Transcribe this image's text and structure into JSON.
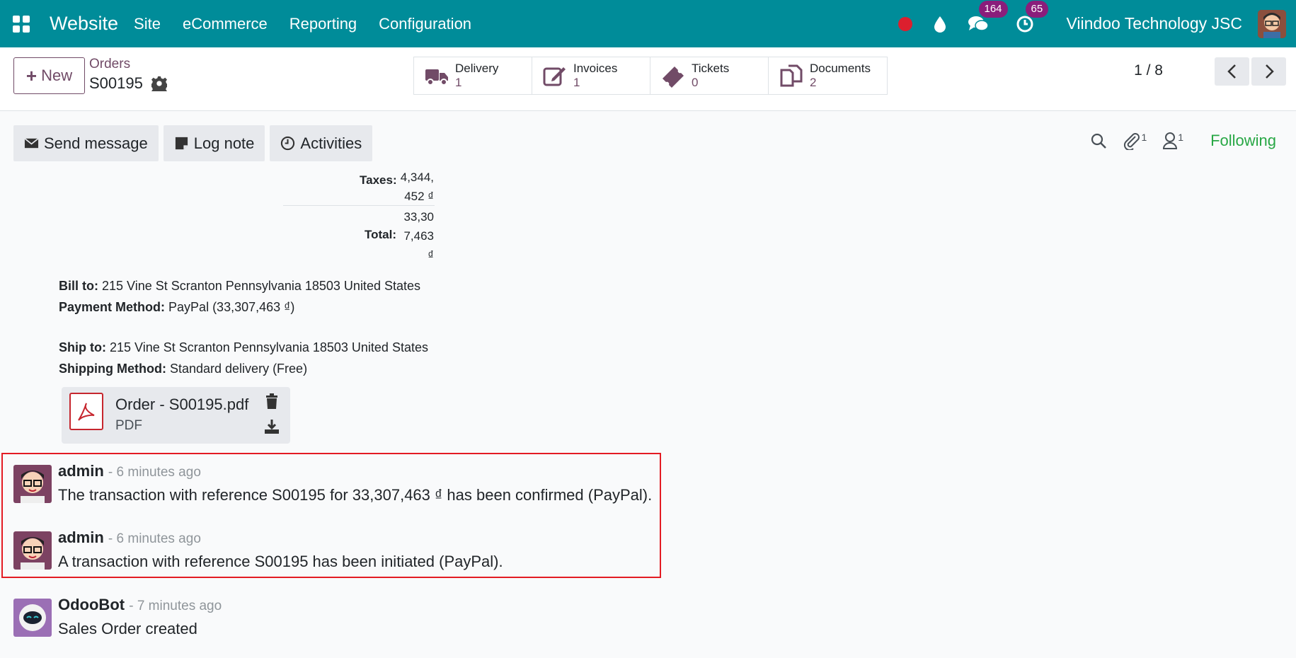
{
  "topbar": {
    "app_name": "Website",
    "menu": [
      "Site",
      "eCommerce",
      "Reporting",
      "Configuration"
    ],
    "messages_badge": "164",
    "activities_badge": "65",
    "company": "Viindoo Technology JSC",
    "accent_color": "#008c99"
  },
  "control": {
    "new_label": "New",
    "breadcrumb_parent": "Orders",
    "breadcrumb_current": "S00195",
    "smart_buttons": [
      {
        "label": "Delivery",
        "value": "1",
        "icon": "truck-icon"
      },
      {
        "label": "Invoices",
        "value": "1",
        "icon": "pencil-square-icon"
      },
      {
        "label": "Tickets",
        "value": "0",
        "icon": "ticket-icon"
      },
      {
        "label": "Documents",
        "value": "2",
        "icon": "files-icon"
      }
    ],
    "pager": "1 / 8"
  },
  "chatter": {
    "send_message": "Send message",
    "log_note": "Log note",
    "activities": "Activities",
    "attachments_count": "1",
    "followers_count": "1",
    "following": "Following"
  },
  "order": {
    "taxes_label": "Taxes:",
    "taxes_value_l1": "4,344,",
    "taxes_value_l2": "452 ₫",
    "total_label": "Total:",
    "total_value_l1": "33,30",
    "total_value_l2": "7,463",
    "total_value_l3": "₫",
    "bill_to_label": "Bill to:",
    "bill_to": "215 Vine St Scranton Pennsylvania 18503 United States",
    "payment_label": "Payment Method:",
    "payment": "PayPal (33,307,463 ₫)",
    "ship_to_label": "Ship to:",
    "ship_to": "215 Vine St Scranton Pennsylvania 18503 United States",
    "shipping_label": "Shipping Method:",
    "shipping": "Standard delivery (Free)"
  },
  "attachment": {
    "name": "Order - S00195.pdf",
    "type": "PDF"
  },
  "messages": [
    {
      "author": "admin",
      "date": "- 6 minutes ago",
      "body": "The transaction with reference S00195 for 33,307,463 ₫ has been confirmed (PayPal)."
    },
    {
      "author": "admin",
      "date": "- 6 minutes ago",
      "body": "A transaction with reference S00195 has been initiated (PayPal)."
    },
    {
      "author": "OdooBot",
      "date": "- 7 minutes ago",
      "body": "Sales Order created"
    }
  ]
}
